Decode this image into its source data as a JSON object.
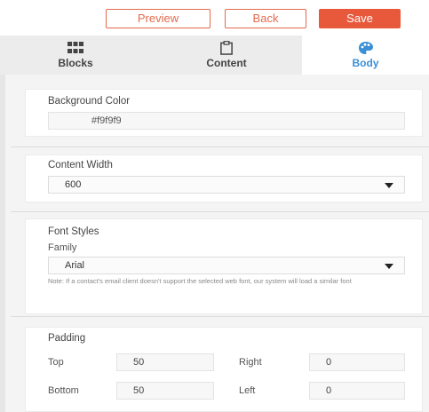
{
  "toolbar": {
    "preview_label": "Preview",
    "back_label": "Back",
    "save_label": "Save",
    "accent_color": "#e8593c"
  },
  "tabs": [
    {
      "label": "Blocks",
      "icon": "grid-icon"
    },
    {
      "label": "Content",
      "icon": "clipboard-icon"
    },
    {
      "label": "Body",
      "icon": "palette-icon",
      "active": true
    }
  ],
  "background_color": {
    "title": "Background Color",
    "value": "#f9f9f9"
  },
  "content_width": {
    "title": "Content Width",
    "selected": "600"
  },
  "font_styles": {
    "title": "Font Styles",
    "family_label": "Family",
    "family_selected": "Arial",
    "note": "Note: If a contact's email client doesn't support the selected web font, our system will load a similar font"
  },
  "padding": {
    "title": "Padding",
    "top_label": "Top",
    "top_value": "50",
    "right_label": "Right",
    "right_value": "0",
    "bottom_label": "Bottom",
    "bottom_value": "50",
    "left_label": "Left",
    "left_value": "0"
  }
}
